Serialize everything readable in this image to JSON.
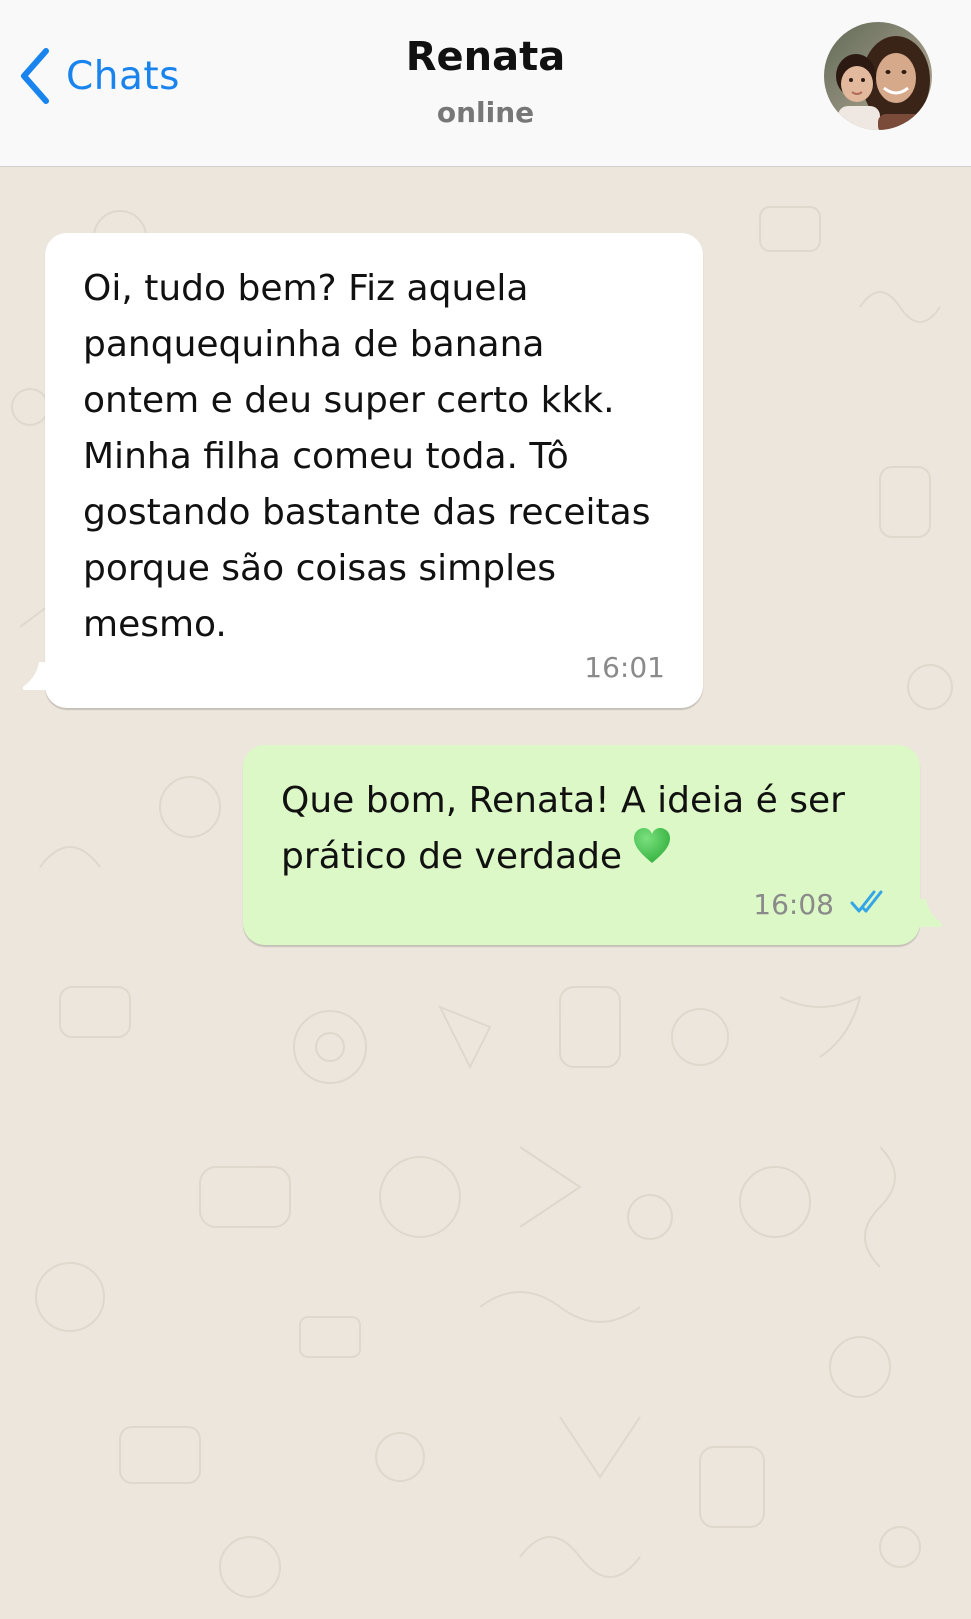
{
  "header": {
    "back_label": "Chats",
    "contact_name": "Renata",
    "contact_status": "online"
  },
  "messages": [
    {
      "direction": "incoming",
      "text": "Oi, tudo bem? Fiz aquela\npanquequinha de banana\nontem e deu super certo kkk.\nMinha filha comeu toda. Tô\ngostando bastante das receitas\nporque são coisas simples\nmesmo.",
      "time": "16:01"
    },
    {
      "direction": "outgoing",
      "text": "Que bom, Renata! A ideia é ser\nprático de verdade",
      "emoji": "green-heart",
      "time": "16:08",
      "status": "read"
    }
  ],
  "colors": {
    "accent": "#1a84ee",
    "outgoing_bubble": "#dcf8c6",
    "incoming_bubble": "#ffffff",
    "chat_background": "#ece6dc",
    "read_ticks": "#34a5e6",
    "heart": "#3cc04a"
  },
  "icons": {
    "back": "chevron-left-icon",
    "read_status": "double-check-icon",
    "emoji": "green-heart-icon"
  }
}
